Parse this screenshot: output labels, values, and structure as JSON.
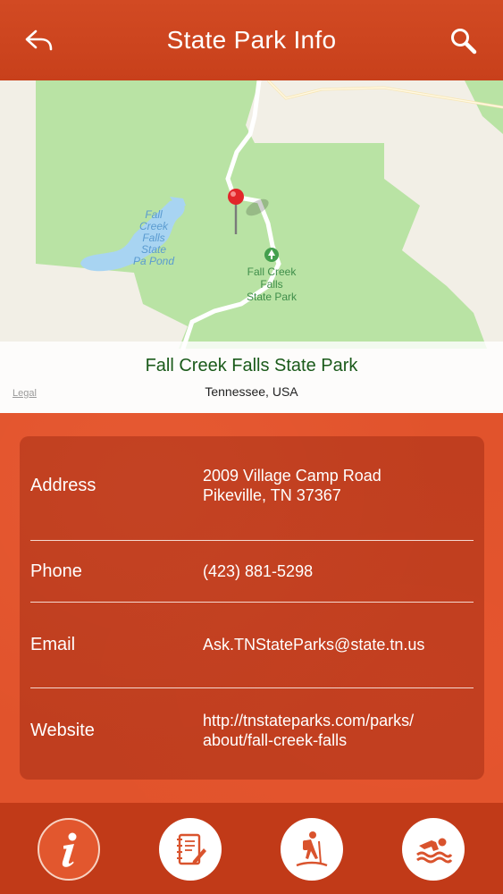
{
  "header": {
    "title": "State Park Info",
    "back_icon": "back-arrow-icon",
    "search_icon": "search-icon"
  },
  "map": {
    "pond_label_lines": [
      "Fall",
      "Creek",
      "Falls",
      "State",
      "Pa Pond"
    ],
    "park_label_lines": [
      "Fall Creek",
      "Falls",
      "State Park"
    ],
    "park_name": "Fall Creek Falls State Park",
    "region": "Tennessee, USA",
    "legal": "Legal",
    "pin_icon": "map-pin-icon"
  },
  "details": {
    "address": {
      "label": "Address",
      "line1": "2009 Village Camp Road",
      "line2": "Pikeville, TN 37367"
    },
    "phone": {
      "label": "Phone",
      "value": "(423) 881-5298"
    },
    "email": {
      "label": "Email",
      "value": "Ask.TNStateParks@state.tn.us"
    },
    "website": {
      "label": "Website",
      "line1": "http://tnstateparks.com/parks/",
      "line2": "about/fall-creek-falls"
    }
  },
  "tabs": [
    {
      "icon": "info-icon",
      "active": true
    },
    {
      "icon": "notebook-icon",
      "active": false
    },
    {
      "icon": "hiker-icon",
      "active": false
    },
    {
      "icon": "swimmer-icon",
      "active": false
    }
  ],
  "colors": {
    "header": "#c8401b",
    "content": "#e1532c",
    "tabbar": "#c13a18",
    "park_green": "#b9e3a4",
    "water": "#a8d4f2"
  }
}
